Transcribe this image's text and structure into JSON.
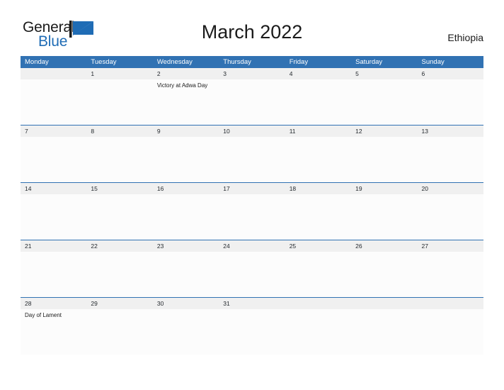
{
  "brand": {
    "name_part1": "General",
    "name_part2": "Blue",
    "logo_icon": "blue-triangle-flag-mark",
    "accent_color": "#1f6cb5"
  },
  "header": {
    "title": "March 2022",
    "region": "Ethiopia"
  },
  "calendar": {
    "month": "March",
    "year": "2022",
    "header_color": "#3172b3",
    "date_band_color": "#f0f0f0",
    "cell_body_color": "#fcfcfc",
    "weekday_headers": [
      "Monday",
      "Tuesday",
      "Wednesday",
      "Thursday",
      "Friday",
      "Saturday",
      "Sunday"
    ],
    "weeks": [
      {
        "days": [
          {
            "date": "",
            "event": ""
          },
          {
            "date": "1",
            "event": ""
          },
          {
            "date": "2",
            "event": "Victory at Adwa Day"
          },
          {
            "date": "3",
            "event": ""
          },
          {
            "date": "4",
            "event": ""
          },
          {
            "date": "5",
            "event": ""
          },
          {
            "date": "6",
            "event": ""
          }
        ]
      },
      {
        "days": [
          {
            "date": "7",
            "event": ""
          },
          {
            "date": "8",
            "event": ""
          },
          {
            "date": "9",
            "event": ""
          },
          {
            "date": "10",
            "event": ""
          },
          {
            "date": "11",
            "event": ""
          },
          {
            "date": "12",
            "event": ""
          },
          {
            "date": "13",
            "event": ""
          }
        ]
      },
      {
        "days": [
          {
            "date": "14",
            "event": ""
          },
          {
            "date": "15",
            "event": ""
          },
          {
            "date": "16",
            "event": ""
          },
          {
            "date": "17",
            "event": ""
          },
          {
            "date": "18",
            "event": ""
          },
          {
            "date": "19",
            "event": ""
          },
          {
            "date": "20",
            "event": ""
          }
        ]
      },
      {
        "days": [
          {
            "date": "21",
            "event": ""
          },
          {
            "date": "22",
            "event": ""
          },
          {
            "date": "23",
            "event": ""
          },
          {
            "date": "24",
            "event": ""
          },
          {
            "date": "25",
            "event": ""
          },
          {
            "date": "26",
            "event": ""
          },
          {
            "date": "27",
            "event": ""
          }
        ]
      },
      {
        "days": [
          {
            "date": "28",
            "event": "Day of Lament"
          },
          {
            "date": "29",
            "event": ""
          },
          {
            "date": "30",
            "event": ""
          },
          {
            "date": "31",
            "event": ""
          },
          {
            "date": "",
            "event": ""
          },
          {
            "date": "",
            "event": ""
          },
          {
            "date": "",
            "event": ""
          }
        ]
      }
    ]
  }
}
